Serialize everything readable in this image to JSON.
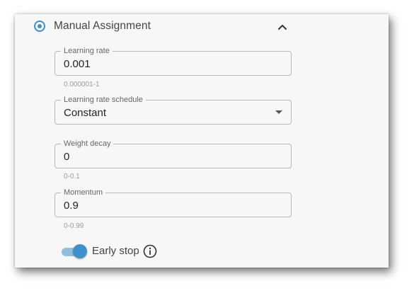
{
  "section": {
    "title": "Manual Assignment",
    "selected": true,
    "expanded": true,
    "accent_color": "#3f8fc9"
  },
  "fields": {
    "learning_rate": {
      "label": "Learning rate",
      "value": "0.001",
      "hint": "0.000001-1"
    },
    "lr_schedule": {
      "label": "Learning rate schedule",
      "value": "Constant"
    },
    "weight_decay": {
      "label": "Weight decay",
      "value": "0",
      "hint": "0-0.1"
    },
    "momentum": {
      "label": "Momentum",
      "value": "0.9",
      "hint": "0-0.99"
    }
  },
  "early_stop": {
    "label": "Early stop",
    "enabled": true,
    "info_icon": "info-circle-icon"
  }
}
